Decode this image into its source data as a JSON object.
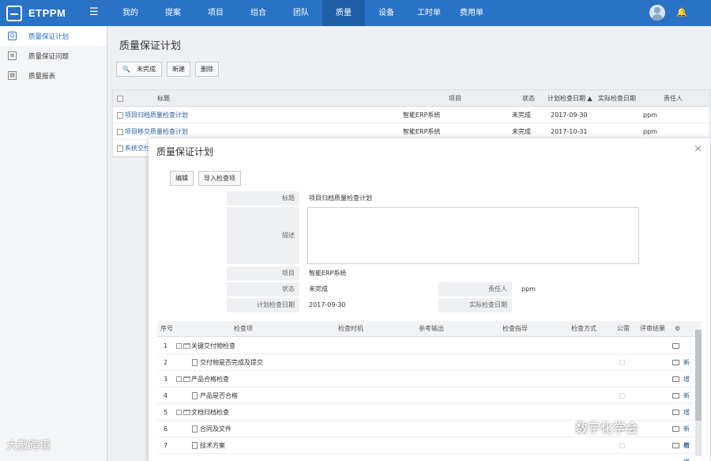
{
  "app": {
    "name": "ETPPM"
  },
  "nav": [
    {
      "label": "我的"
    },
    {
      "label": "提案"
    },
    {
      "label": "项目"
    },
    {
      "label": "组合"
    },
    {
      "label": "团队"
    },
    {
      "label": "质量"
    },
    {
      "label": "设备"
    },
    {
      "label": "工时单"
    },
    {
      "label": "费用单"
    }
  ],
  "sidebar": {
    "items": [
      {
        "label": "质量保证计划"
      },
      {
        "label": "质量保证问题"
      },
      {
        "label": "质量报表"
      }
    ]
  },
  "list": {
    "title": "质量保证计划",
    "search_label": "未完成",
    "new_label": "新建",
    "delete_label": "删除",
    "headers": {
      "title": "标题",
      "project": "项目",
      "status": "状态",
      "plan_date": "计划检查日期",
      "actual_date": "实际检查日期",
      "owner": "责任人"
    },
    "rows": [
      {
        "title": "项目归档质量检查计划",
        "project": "智能ERP系统",
        "status": "未完成",
        "plan_date": "2017-09-30",
        "owner": "ppm"
      },
      {
        "title": "项目移交质量检查计划",
        "project": "智能ERP系统",
        "status": "未完成",
        "plan_date": "2017-10-31",
        "owner": "ppm"
      },
      {
        "title": "系统交付",
        "project": "",
        "status": "",
        "plan_date": "",
        "owner": ""
      }
    ]
  },
  "modal": {
    "title": "质量保证计划",
    "close": "×",
    "edit_label": "编辑",
    "import_label": "导入检查项",
    "form": {
      "title_label": "标题",
      "title_value": "项目归档质量检查计划",
      "desc_label": "描述",
      "project_label": "项目",
      "project_value": "智能ERP系统",
      "status_label": "状态",
      "status_value": "未完成",
      "owner_label": "责任人",
      "owner_value": "ppm",
      "plan_label": "计划检查日期",
      "plan_value": "2017-09-30",
      "actual_label": "实际检查日期",
      "actual_value": ""
    },
    "checklist": {
      "headers": {
        "seq": "序号",
        "item": "检查项",
        "timing": "检查时机",
        "ref": "参考输出",
        "guide": "检查指导",
        "method": "检查方式",
        "public": "公需",
        "result": "评审结果"
      },
      "rows": [
        {
          "seq": "1",
          "item": "关键交付物检查",
          "type": "folder",
          "link": ""
        },
        {
          "seq": "2",
          "item": "交付物是否完成及提交",
          "type": "doc",
          "link": "新增"
        },
        {
          "seq": "3",
          "item": "产品合格检查",
          "type": "folder",
          "link": ""
        },
        {
          "seq": "4",
          "item": "产品是否合格",
          "type": "doc",
          "link": "新增"
        },
        {
          "seq": "5",
          "item": "文档归档检查",
          "type": "folder",
          "link": ""
        },
        {
          "seq": "6",
          "item": "合同及文件",
          "type": "doc",
          "link": "新增"
        },
        {
          "seq": "7",
          "item": "技术方案",
          "type": "doc",
          "link": "新增"
        }
      ]
    }
  },
  "watermarks": {
    "left": "大數跨境",
    "right": "数字化学会"
  },
  "colors": {
    "topbar": "#2a72c6",
    "active_nav": "#1e5fa8",
    "link": "#2a5da8"
  }
}
